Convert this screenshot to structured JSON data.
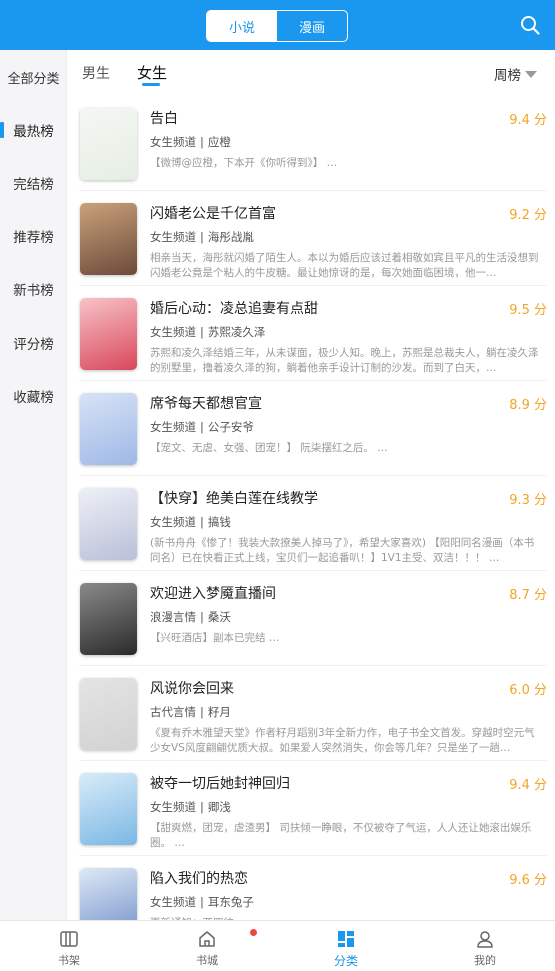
{
  "header": {
    "tabs": [
      {
        "label": "小说",
        "active": true
      },
      {
        "label": "漫画",
        "active": false
      }
    ],
    "search_icon": "search-icon"
  },
  "rail": {
    "items": [
      "全部分类",
      "最热榜",
      "完结榜",
      "推荐榜",
      "新书榜",
      "评分榜",
      "收藏榜"
    ],
    "active": "最热榜"
  },
  "subtabs": {
    "items": [
      "男生",
      "女生"
    ],
    "active": "女生",
    "sort_label": "周榜"
  },
  "books": [
    {
      "title": "告白",
      "score": "9.4 分",
      "channel": "女生频道",
      "author": "应橙",
      "desc": "【微博@应橙，下本开《你听得到》】 …",
      "cover": [
        "#f4f7f3",
        "#e6eee4"
      ]
    },
    {
      "title": "闪婚老公是千亿首富",
      "score": "9.2 分",
      "channel": "女生频道",
      "author": "海彤战胤",
      "desc": "相亲当天，海彤就闪婚了陌生人。本以为婚后应该过着相敬如宾且平凡的生活没想到闪婚老公竟是个粘人的牛皮糖。最让她惊讶的是，每次她面临困境，他一…",
      "cover": [
        "#caa27a",
        "#6b4a3a"
      ]
    },
    {
      "title": "婚后心动：凌总追妻有点甜",
      "score": "9.5 分",
      "channel": "女生频道",
      "author": "苏熙凌久泽",
      "desc": "苏熙和凌久泽结婚三年，从未谋面，极少人知。晚上，苏熙是总裁夫人，躺在凌久泽的别墅里，撸着凌久泽的狗，躺着他亲手设计订制的沙发。而到了白天，…",
      "cover": [
        "#f7c3c8",
        "#d9475b"
      ]
    },
    {
      "title": "席爷每天都想官宣",
      "score": "8.9 分",
      "channel": "女生频道",
      "author": "公子安爷",
      "desc": "【宠文、无虐、女强、团宠！】 阮柒摆红之后。 …",
      "cover": [
        "#d7e3f6",
        "#9fb8e6"
      ]
    },
    {
      "title": "【快穿】绝美白莲在线教学",
      "score": "9.3 分",
      "channel": "女生频道",
      "author": "搞钱",
      "desc": "(新书舟舟《惨了！我装大款撩美人掉马了》，希望大家喜欢) 【阳阳同名漫画（本书同名）已在快看正式上线，宝贝们一起追番叭！】1V1主受、双洁！！！ …",
      "cover": [
        "#eef0f7",
        "#b9bfd8"
      ]
    },
    {
      "title": "欢迎进入梦魇直播间",
      "score": "8.7 分",
      "channel": "浪漫言情",
      "author": "桑沃",
      "desc": "【兴旺酒店】副本已完结 …",
      "cover": [
        "#8a8a8a",
        "#2a2a2a"
      ]
    },
    {
      "title": "风说你会回来",
      "score": "6.0 分",
      "channel": "古代言情",
      "author": "籽月",
      "desc": "《夏有乔木雅望天堂》作者籽月蹈别3年全新力作，电子书全文首发。穿越时空元气少女VS风度翩翩优质大叔。如果爱人突然消失，你会等几年？只是坐了一趟…",
      "cover": [
        "#e4e4e4",
        "#d2d2d2"
      ]
    },
    {
      "title": "被夺一切后她封神回归",
      "score": "9.4 分",
      "channel": "女生频道",
      "author": "卿浅",
      "desc": "【甜爽燃，团宠，虐渣男】 司扶倾一睁眼，不仅被夺了气运，人人还让她滚出娱乐圈。 …",
      "cover": [
        "#d8ecf8",
        "#7bb7e4"
      ]
    },
    {
      "title": "陷入我们的热恋",
      "score": "9.6 分",
      "channel": "女生频道",
      "author": "耳东兔子",
      "desc": "更新通知：两四往 …",
      "cover": [
        "#dfe9f7",
        "#6f8fc7"
      ]
    }
  ],
  "bottom_nav": {
    "items": [
      {
        "label": "书架",
        "icon": "bookshelf-icon",
        "active": false
      },
      {
        "label": "书城",
        "icon": "home-icon",
        "active": false
      },
      {
        "label": "分类",
        "icon": "category-icon",
        "active": true
      },
      {
        "label": "我的",
        "icon": "profile-icon",
        "active": false
      }
    ]
  },
  "colors": {
    "accent": "#1a98ef",
    "score": "#f4a423",
    "badge": "#e8493b"
  }
}
